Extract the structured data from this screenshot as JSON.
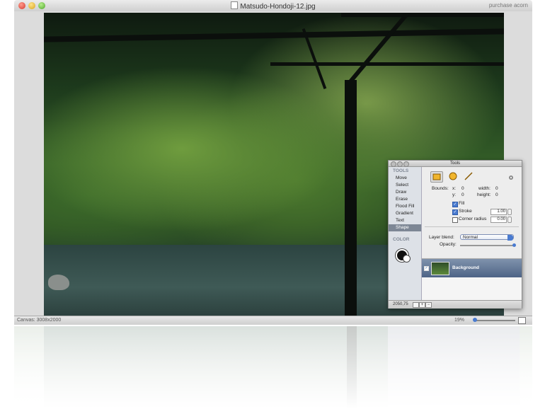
{
  "window": {
    "title": "Matsudo-Hondoji-12.jpg",
    "purchase": "purchase acorn"
  },
  "statusbar": {
    "canvas_label": "Canvas: 3008x2000",
    "zoom": "19%"
  },
  "tools_panel": {
    "title": "Tools",
    "tools_header": "TOOLS",
    "tools": [
      "Move",
      "Select",
      "Draw",
      "Erase",
      "Flood Fill",
      "Gradient",
      "Text",
      "Shape"
    ],
    "selected_tool": "Shape",
    "color_header": "COLOR",
    "bounds_label": "Bounds:",
    "x_label": "x:",
    "x_value": "0",
    "y_label": "y:",
    "y_value": "0",
    "width_label": "width:",
    "width_value": "0",
    "height_label": "height:",
    "height_value": "0",
    "fill_label": "Fill",
    "fill_checked": true,
    "stroke_label": "Stroke",
    "stroke_checked": true,
    "stroke_value": "1.00",
    "corner_label": "Corner radius",
    "corner_checked": false,
    "corner_value": "0.00",
    "blend_label": "Layer blend:",
    "blend_value": "Normal",
    "opacity_label": "Opacity:",
    "opacity_level": 1.0,
    "layer_name": "Background",
    "coords": "2050,75"
  },
  "colors": {
    "selection_accent": "#4a7bd0",
    "selected_tool_bg": "#7d8795"
  }
}
